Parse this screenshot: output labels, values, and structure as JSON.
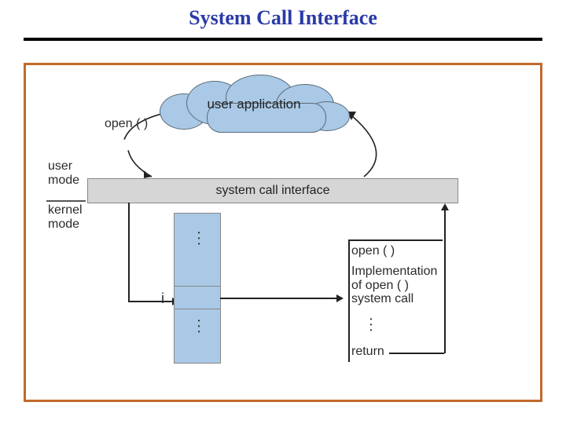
{
  "title": "System Call Interface",
  "cloud_label": "user application",
  "open_label_top": "open ( )",
  "open_label_right": "open ( )",
  "user_mode": "user\nmode",
  "kernel_mode": "kernel\nmode",
  "syscall_bar": "system call interface",
  "vector_index": "i",
  "impl_text": "Implementation\nof open ( )\nsystem call",
  "return_label": "return"
}
